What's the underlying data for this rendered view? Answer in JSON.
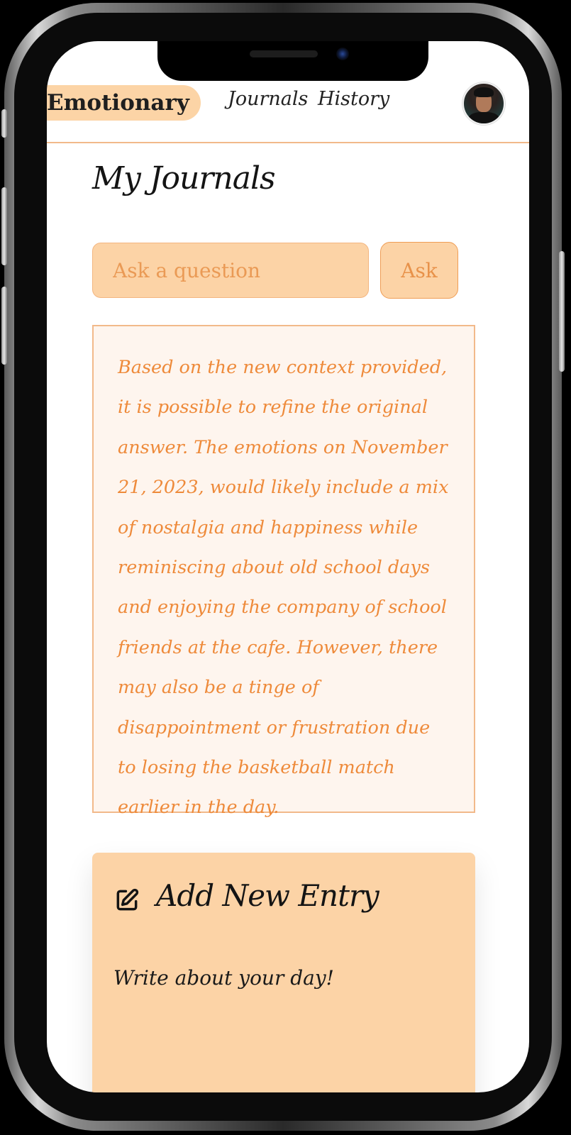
{
  "header": {
    "brand": "Emotionary",
    "nav": {
      "journals": "Journals",
      "history": "History"
    }
  },
  "main": {
    "title": "My Journals",
    "ask": {
      "placeholder": "Ask a question",
      "button_label": "Ask"
    },
    "answer": "Based on the new context provided, it is possible to refine the original answer. The emotions on November 21, 2023, would likely include a mix of nostalgia and happiness while reminiscing about old school days and enjoying the company of school friends at the cafe. However, there may also be a tinge of disappointment or frustration due to losing the basketball match earlier in the day.",
    "new_entry": {
      "title": "Add New Entry",
      "placeholder": "Write about your day!",
      "icon": "edit-icon"
    }
  },
  "colors": {
    "accent": "#fcd3a6",
    "accent_text": "#ee8a3a",
    "answer_bg": "#fef5ee",
    "border": "#f2b98a"
  }
}
